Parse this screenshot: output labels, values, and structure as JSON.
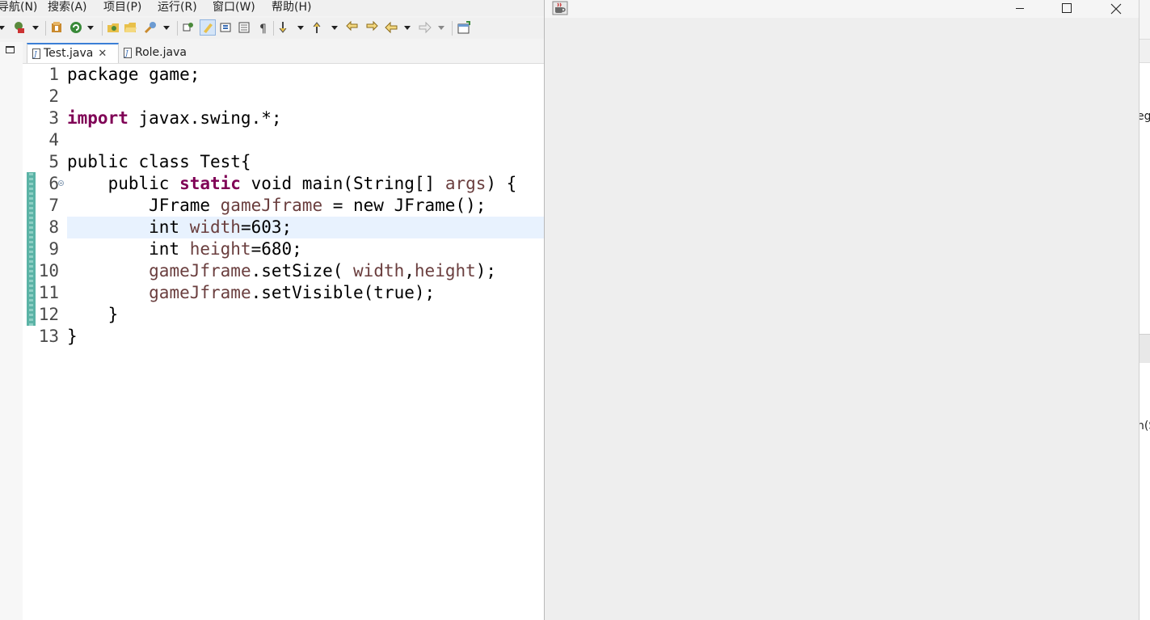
{
  "menu": {
    "items": [
      "导航(N)",
      "搜索(A)",
      "项目(P)",
      "运行(R)",
      "窗口(W)",
      "帮助(H)"
    ]
  },
  "toolbar": {
    "icons": [
      "new-dropdown-arrow",
      "debug-icon",
      "run-icon",
      "external-tools-icon",
      "open-type-icon",
      "open-folder-icon",
      "search-icon",
      "toggle-mark-icon",
      "highlight-icon",
      "block-select-icon",
      "whitespace-icon",
      "pilcrow-icon",
      "next-annotation-icon",
      "prev-annotation-icon",
      "last-edit-icon",
      "back-icon",
      "forward-icon",
      "perspective-icon"
    ]
  },
  "tabs": [
    {
      "label": "Test.java",
      "active": true,
      "closable": true
    },
    {
      "label": "Role.java",
      "active": false,
      "closable": false
    }
  ],
  "editor": {
    "current_line": 8,
    "lines": [
      {
        "n": "1",
        "tokens": [
          {
            "t": "package game;",
            "c": ""
          }
        ]
      },
      {
        "n": "2",
        "tokens": []
      },
      {
        "n": "3",
        "tokens": [
          {
            "t": "import",
            "c": "kw"
          },
          {
            "t": " javax.swing.*;",
            "c": ""
          }
        ]
      },
      {
        "n": "4",
        "tokens": []
      },
      {
        "n": "5",
        "tokens": [
          {
            "t": "public class Test{",
            "c": ""
          }
        ]
      },
      {
        "n": "6",
        "tokens": [
          {
            "t": "    public ",
            "c": ""
          },
          {
            "t": "static",
            "c": "kw"
          },
          {
            "t": " void main(String[] ",
            "c": ""
          },
          {
            "t": "args",
            "c": "var"
          },
          {
            "t": ") {",
            "c": ""
          }
        ]
      },
      {
        "n": "7",
        "tokens": [
          {
            "t": "        JFrame ",
            "c": ""
          },
          {
            "t": "gameJframe",
            "c": "var"
          },
          {
            "t": " = new JFrame();",
            "c": ""
          }
        ]
      },
      {
        "n": "8",
        "tokens": [
          {
            "t": "        int ",
            "c": ""
          },
          {
            "t": "width",
            "c": "var"
          },
          {
            "t": "=603;",
            "c": ""
          }
        ]
      },
      {
        "n": "9",
        "tokens": [
          {
            "t": "        int ",
            "c": ""
          },
          {
            "t": "height",
            "c": "var"
          },
          {
            "t": "=680;",
            "c": ""
          }
        ]
      },
      {
        "n": "10",
        "tokens": [
          {
            "t": "        ",
            "c": ""
          },
          {
            "t": "gameJframe",
            "c": "var"
          },
          {
            "t": ".setSize( ",
            "c": ""
          },
          {
            "t": "width",
            "c": "var"
          },
          {
            "t": ",",
            "c": ""
          },
          {
            "t": "height",
            "c": "var"
          },
          {
            "t": ");",
            "c": ""
          }
        ]
      },
      {
        "n": "11",
        "tokens": [
          {
            "t": "        ",
            "c": ""
          },
          {
            "t": "gameJframe",
            "c": "var"
          },
          {
            "t": ".setVisible(true);",
            "c": ""
          }
        ]
      },
      {
        "n": "12",
        "tokens": [
          {
            "t": "    }",
            "c": ""
          }
        ]
      },
      {
        "n": "13",
        "tokens": [
          {
            "t": "}",
            "c": ""
          }
        ]
      }
    ]
  },
  "jframe": {
    "controls": [
      "minimize",
      "maximize",
      "close"
    ]
  },
  "right_edge": {
    "text1": "eg",
    "text2": "n(S"
  },
  "colors": {
    "keyword": "#7f0055",
    "variable": "#6a3e3e",
    "current_line": "#e8f2fe",
    "frame_bg": "#eeeeee"
  }
}
